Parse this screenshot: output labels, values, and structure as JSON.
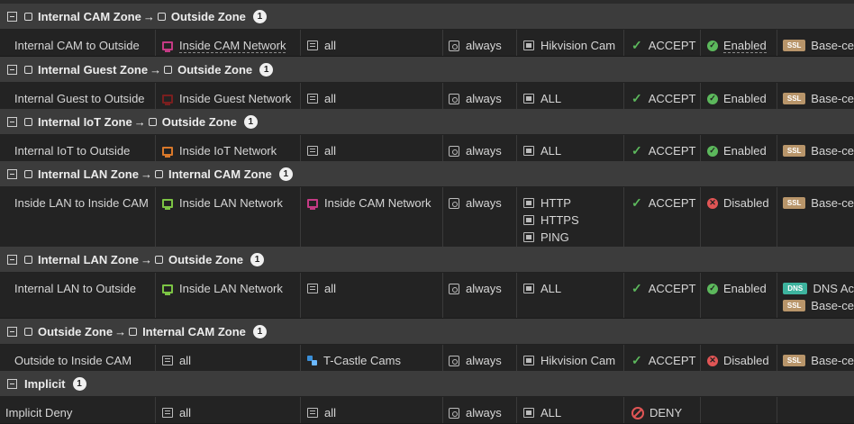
{
  "colors": {
    "cam": "#c43a84",
    "guest": "#7a1f1f",
    "iot": "#d9782a",
    "lan": "#7cc444",
    "accept": "#5cb85c",
    "deny": "#e05555"
  },
  "groups": [
    {
      "from": "Internal CAM Zone",
      "to": "Outside Zone",
      "count": "1"
    },
    {
      "from": "Internal Guest Zone",
      "to": "Outside Zone",
      "count": "1"
    },
    {
      "from": "Internal IoT Zone",
      "to": "Outside Zone",
      "count": "1"
    },
    {
      "from": "Internal LAN Zone",
      "to": "Internal CAM Zone",
      "count": "1"
    },
    {
      "from": "Internal LAN Zone",
      "to": "Outside Zone",
      "count": "1"
    },
    {
      "from": "Outside Zone",
      "to": "Internal CAM Zone",
      "count": "1"
    },
    {
      "label": "Implicit",
      "count": "1"
    }
  ],
  "arrow": "→",
  "rows": [
    {
      "name": "Internal CAM to Outside",
      "src": "Inside CAM Network",
      "dst": "all",
      "schedule": "always",
      "services": [
        "Hikvision Cam"
      ],
      "action": "ACCEPT",
      "status": "Enabled",
      "profiles": [
        {
          "badge": "SSL",
          "text": "Base-ce"
        }
      ]
    },
    {
      "name": "Internal Guest to Outside",
      "src": "Inside Guest Network",
      "dst": "all",
      "schedule": "always",
      "services": [
        "ALL"
      ],
      "action": "ACCEPT",
      "status": "Enabled",
      "profiles": [
        {
          "badge": "SSL",
          "text": "Base-ce"
        }
      ]
    },
    {
      "name": "Internal IoT to Outside",
      "src": "Inside IoT Network",
      "dst": "all",
      "schedule": "always",
      "services": [
        "ALL"
      ],
      "action": "ACCEPT",
      "status": "Enabled",
      "profiles": [
        {
          "badge": "SSL",
          "text": "Base-ce"
        }
      ]
    },
    {
      "name": "Inside LAN to Inside CAM",
      "src": "Inside LAN Network",
      "dst": "Inside CAM Network",
      "schedule": "always",
      "services": [
        "HTTP",
        "HTTPS",
        "PING"
      ],
      "action": "ACCEPT",
      "status": "Disabled",
      "profiles": [
        {
          "badge": "SSL",
          "text": "Base-ce"
        }
      ]
    },
    {
      "name": "Internal LAN to Outside",
      "src": "Inside LAN Network",
      "dst": "all",
      "schedule": "always",
      "services": [
        "ALL"
      ],
      "action": "ACCEPT",
      "status": "Enabled",
      "profiles": [
        {
          "badge": "DNS",
          "text": "DNS Ac"
        },
        {
          "badge": "SSL",
          "text": "Base-ce"
        }
      ]
    },
    {
      "name": "Outside to Inside CAM",
      "src": "all",
      "dst": "T-Castle Cams",
      "schedule": "always",
      "services": [
        "Hikvision Cam"
      ],
      "action": "ACCEPT",
      "status": "Disabled",
      "profiles": [
        {
          "badge": "SSL",
          "text": "Base-ce"
        }
      ]
    },
    {
      "name": "Implicit Deny",
      "src": "all",
      "dst": "all",
      "schedule": "always",
      "services": [
        "ALL"
      ],
      "action": "DENY",
      "status": "",
      "profiles": []
    }
  ]
}
